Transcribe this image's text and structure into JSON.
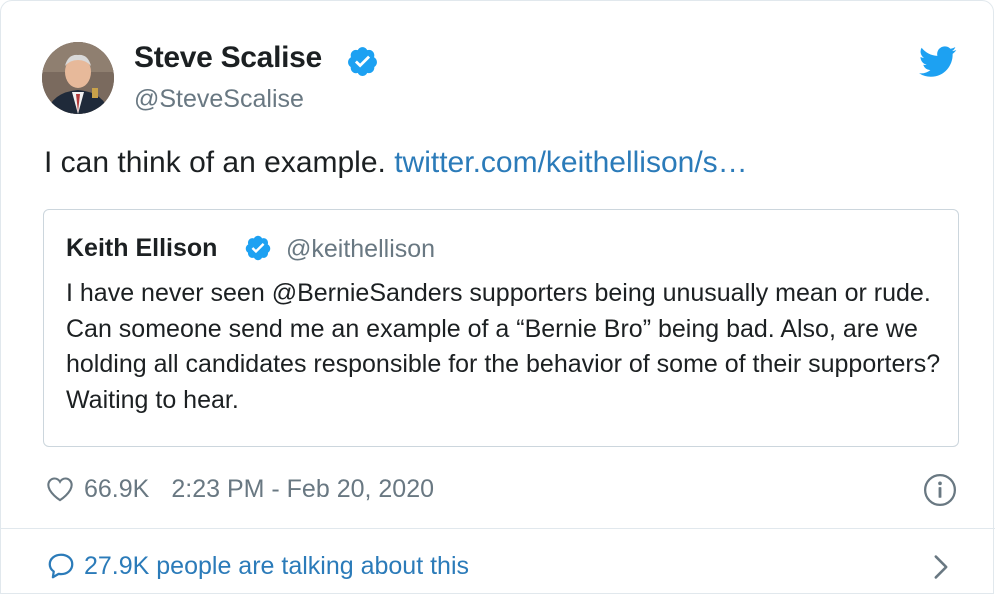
{
  "author": {
    "name": "Steve Scalise",
    "handle": "@SteveScalise"
  },
  "tweet": {
    "text": "I can think of an example.",
    "link": "twitter.com/keithellison/s…"
  },
  "quoted": {
    "name": "Keith Ellison",
    "handle": "@keithellison",
    "text": "I have never seen @BernieSanders supporters being unusually mean or rude. Can someone send me an example of a “Bernie Bro” being bad. Also, are we holding all candidates responsible for the behavior of some of their supporters? Waiting to hear."
  },
  "meta": {
    "likes": "66.9K",
    "timestamp": "2:23 PM - Feb 20, 2020"
  },
  "footer": {
    "conversation": "27.9K people are talking about this"
  },
  "icons": {
    "verified": "verified-badge-icon",
    "brand": "twitter-bird-icon",
    "like": "heart-icon",
    "info": "info-icon",
    "conversation": "speech-bubble-icon",
    "more": "chevron-right-icon"
  },
  "colors": {
    "link": "#2b7bb9",
    "verified": "#1da1f2",
    "muted": "#697882",
    "border": "#e1e8ed"
  }
}
